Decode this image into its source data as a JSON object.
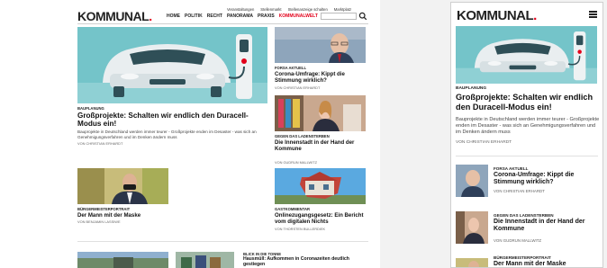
{
  "brand": {
    "name": "KOMMUNAL",
    "dot": ".",
    "accent": "#e2001a"
  },
  "topnav": [
    "Veranstaltungen",
    "Stellenmarkt",
    "Stellenanzeige schalten",
    "Marktplatz"
  ],
  "mainnav": [
    "HOME",
    "POLITIK",
    "RECHT",
    "PANORAMA",
    "PRAXIS",
    "KOMMUNALWELT"
  ],
  "hero": {
    "kicker": "BAUPLANUNG",
    "title": "Großprojekte: Schalten wir endlich den Duracell-Modus ein!",
    "teaser": "Bauprojekte in Deutschland werden immer teurer - Großprojekte enden im Desaster - was sich an Genehmigungsverfahren und im Denken ändern muss",
    "author": "VON CHRISTIAN ERHARDT"
  },
  "side": [
    {
      "kicker": "FORSA AKTUELL",
      "title": "Corona-Umfrage: Kippt die Stimmung wirklich?",
      "author": "VON CHRISTIAN ERHARDT"
    },
    {
      "kicker": "GEGEN DAS LADENSTERBEN",
      "title": "Die Innenstadt in der Hand der Kommune",
      "author": "VON GUDRUN MALLWITZ"
    }
  ],
  "row2": [
    {
      "kicker": "BÜRGERMEISTERPORTRAIT",
      "title": "Der Mann mit der Maske",
      "author": "VON BENJAMIN LASSIWE"
    },
    {
      "kicker": "GASTKOMMENTAR",
      "title": "Onlinezugangsgesetz: Ein Bericht vom digitalen Nichts",
      "author": "VON THORSTEN BULLERDIEK"
    }
  ],
  "row3": {
    "kicker": "BLICK IN DIE TONNE",
    "title": "Hausmüll: Aufkommen in Coronazeiten deutlich gestiegen"
  },
  "mobile": {
    "hero": {
      "kicker": "BAUPLANUNG",
      "title": "Großprojekte: Schalten wir endlich den Duracell-Modus ein!",
      "teaser": "Bauprojekte in Deutschland werden immer teurer - Großprojekte enden im Desaster - was sich an Genehmigungsverfahren und im Denken ändern muss",
      "author": "VON CHRISTIAN ERHARDT"
    },
    "items": [
      {
        "kicker": "FORSA AKTUELL",
        "title": "Corona-Umfrage: Kippt die Stimmung wirklich?",
        "author": "VON CHRISTIAN ERHARDT"
      },
      {
        "kicker": "GEGEN DAS LADENSTERBEN",
        "title": "Die Innenstadt in der Hand der Kommune",
        "author": "VON GUDRUN MALLWITZ"
      },
      {
        "kicker": "BÜRGERMEISTERPORTRAIT",
        "title": "Der Mann mit der Maske"
      }
    ]
  },
  "icons": {
    "search": "search-icon",
    "menu": "hamburger-menu-icon"
  }
}
